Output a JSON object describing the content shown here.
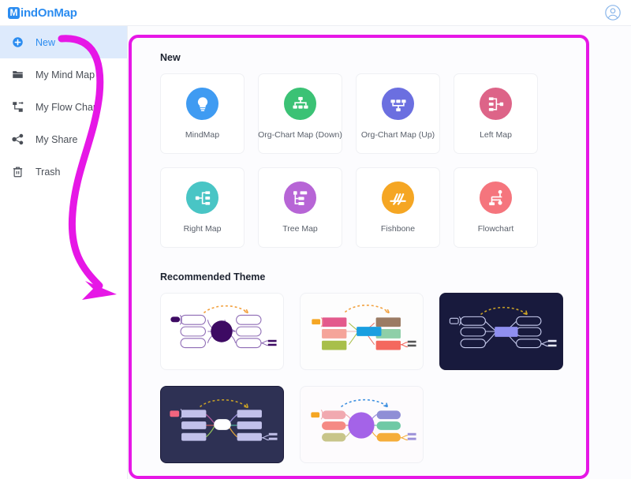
{
  "app": {
    "logo_badge": "M",
    "logo_text": "indOnMap",
    "accent": "#2b8cf0",
    "annotation_color": "#e617e6"
  },
  "topbar": {
    "avatar_icon": "user-circle-icon"
  },
  "sidebar": {
    "items": [
      {
        "label": "New",
        "icon": "plus-circle-icon",
        "active": true
      },
      {
        "label": "My Mind Map",
        "icon": "folder-icon",
        "active": false
      },
      {
        "label": "My Flow Chart",
        "icon": "flow-chart-icon",
        "active": false
      },
      {
        "label": "My Share",
        "icon": "share-icon",
        "active": false
      },
      {
        "label": "Trash",
        "icon": "trash-icon",
        "active": false
      }
    ]
  },
  "main": {
    "new_section": {
      "title": "New",
      "cards": [
        {
          "label": "MindMap",
          "icon": "lightbulb-icon",
          "color": "#3f9bf2"
        },
        {
          "label": "Org-Chart Map (Down)",
          "icon": "org-chart-down-icon",
          "color": "#3bc275"
        },
        {
          "label": "Org-Chart Map (Up)",
          "icon": "org-chart-up-icon",
          "color": "#6b6fe0"
        },
        {
          "label": "Left Map",
          "icon": "left-map-icon",
          "color": "#dd6488"
        },
        {
          "label": "Right Map",
          "icon": "right-map-icon",
          "color": "#49c5c5"
        },
        {
          "label": "Tree Map",
          "icon": "tree-map-icon",
          "color": "#b765d6"
        },
        {
          "label": "Fishbone",
          "icon": "fishbone-icon",
          "color": "#f5a623"
        },
        {
          "label": "Flowchart",
          "icon": "flowchart-icon",
          "color": "#f5757d"
        }
      ]
    },
    "theme_section": {
      "title": "Recommended Theme",
      "themes": [
        {
          "name": "purple-classic-theme",
          "background": "#ffffff",
          "center_color": "#3d0a63",
          "node_style": "outline-pill",
          "accent": "#8e6bb5"
        },
        {
          "name": "colorful-rect-theme",
          "background": "#fdfdfd",
          "center_color": "#1a9fe0",
          "node_style": "filled-rect",
          "accent": "#f1a0a6"
        },
        {
          "name": "dark-navy-theme",
          "background": "#181a3d",
          "center_color": "#8f8ff0",
          "node_style": "outline-pill",
          "accent": "#c9a227"
        },
        {
          "name": "dark-lavender-theme",
          "background": "#2e3154",
          "center_color": "#ffffff",
          "node_style": "filled-pill",
          "accent": "#c9a227"
        },
        {
          "name": "light-purple-circle-theme",
          "background": "#fdfbfd",
          "center_color": "#a463e8",
          "node_style": "filled-pill",
          "accent": "#3b8fe0"
        }
      ]
    }
  },
  "annotations": {
    "arrow": {
      "name": "arrow-pointing-to-new-panel",
      "color": "#e617e6"
    },
    "highlight_box": {
      "name": "content-panel-highlight",
      "color": "#e617e6"
    }
  }
}
